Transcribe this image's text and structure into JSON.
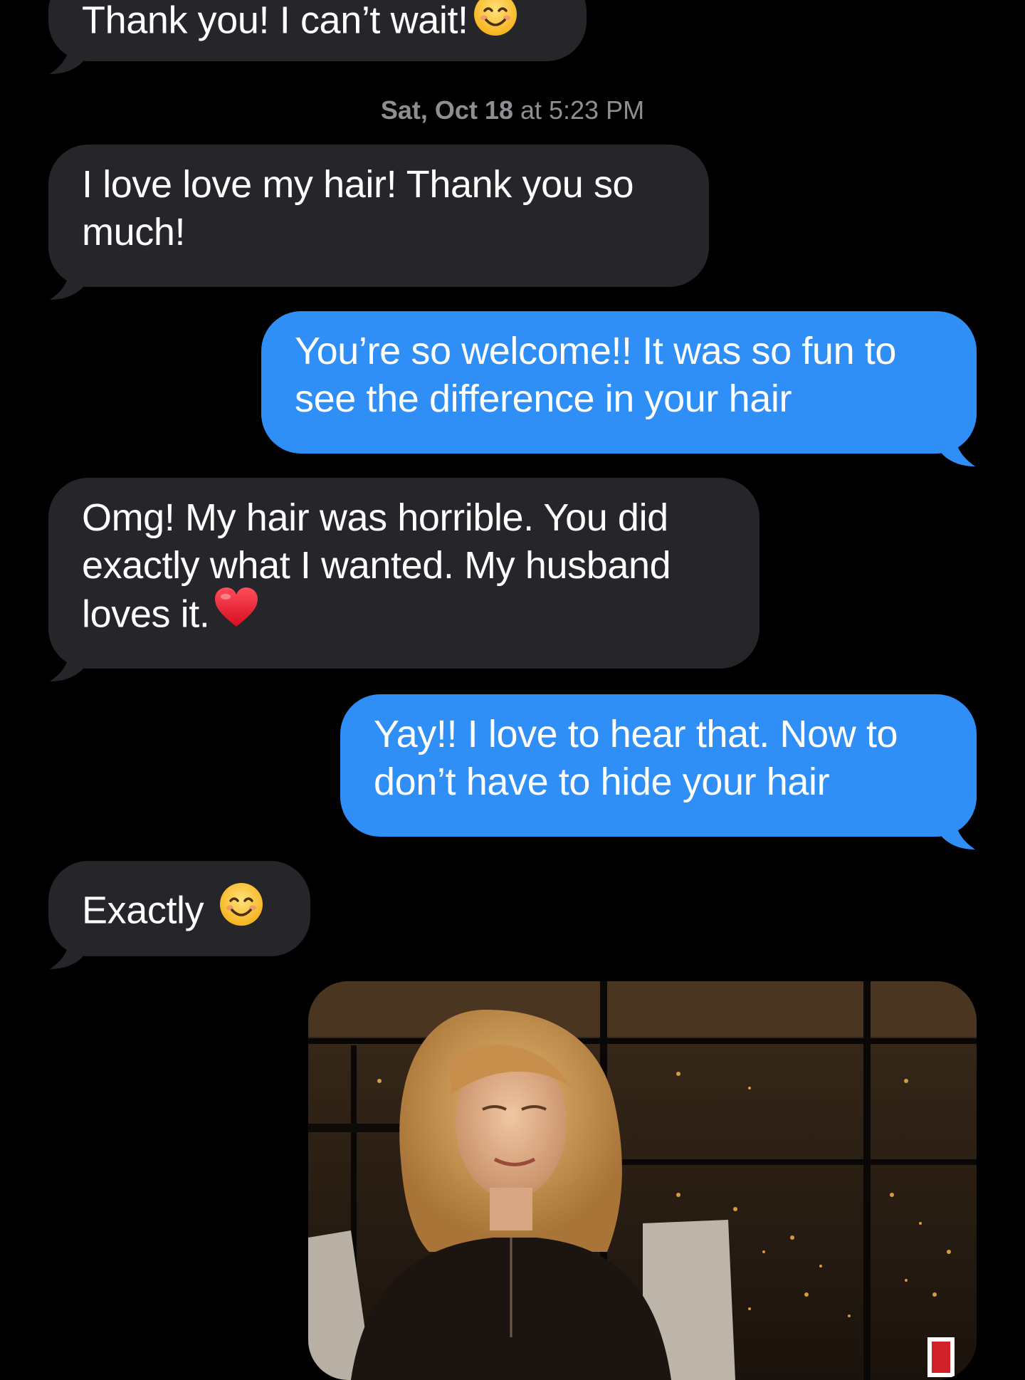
{
  "messages": [
    {
      "id": "m1",
      "direction": "incoming",
      "text": "Thank you! I can’t wait!",
      "emoji": "smiling-face-icon"
    },
    {
      "id": "m2",
      "direction": "incoming",
      "text": "I love love my hair! Thank you so\nmuch!"
    },
    {
      "id": "m3",
      "direction": "outgoing",
      "text": "You’re so welcome!! It was so fun to\nsee the difference in your hair"
    },
    {
      "id": "m4",
      "direction": "incoming",
      "text": "Omg! My hair was horrible. You did\nexactly what I wanted. My husband\nloves it.",
      "emoji": "red-heart-icon"
    },
    {
      "id": "m5",
      "direction": "outgoing",
      "text": "Yay!! I love to hear that. Now to\ndon’t have to hide your hair"
    },
    {
      "id": "m6",
      "direction": "incoming",
      "text": "Exactly ",
      "emoji": "smiling-face-icon"
    }
  ],
  "timestamp": {
    "date": "Sat, Oct 18",
    "sep": " at ",
    "time": "5:23 PM"
  },
  "gif": {
    "watermark": "E!",
    "icon": "gif-image"
  },
  "colors": {
    "background": "#000000",
    "incoming_bubble": "#26252a",
    "outgoing_bubble": "#2f8ff7",
    "timestamp_text": "#8e8e93"
  }
}
